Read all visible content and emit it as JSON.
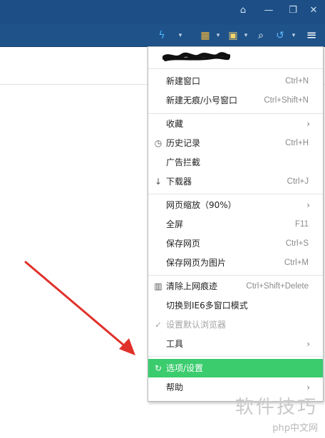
{
  "window": {
    "buttons": [
      {
        "name": "shirt-icon",
        "glyph": "⌂"
      },
      {
        "name": "minimize-icon",
        "glyph": "—"
      },
      {
        "name": "restore-icon",
        "glyph": "❐"
      },
      {
        "name": "close-icon",
        "glyph": "✕"
      }
    ]
  },
  "toolbar": {
    "lightning_icon": "ϟ",
    "dropdown": "▾",
    "apps_icon": "▦",
    "notes_icon": "▣",
    "search_icon": "⌕",
    "undo_icon": "↺",
    "menu_icon": "≡"
  },
  "menu": {
    "items": [
      {
        "label": "新建窗口",
        "shortcut": "Ctrl+N"
      },
      {
        "label": "新建无痕/小号窗口",
        "shortcut": "Ctrl+Shift+N"
      },
      {
        "label": "收藏",
        "submenu": "›"
      },
      {
        "label": "历史记录",
        "shortcut": "Ctrl+H",
        "icon": "clock-icon",
        "glyph": "◷"
      },
      {
        "label": "广告拦截"
      },
      {
        "label": "下载器",
        "shortcut": "Ctrl+J",
        "icon": "download-icon",
        "glyph": "↓"
      },
      {
        "label": "网页缩放（90%）",
        "submenu": "›"
      },
      {
        "label": "全屏",
        "shortcut": "F11"
      },
      {
        "label": "保存网页",
        "shortcut": "Ctrl+S"
      },
      {
        "label": "保存网页为图片",
        "shortcut": "Ctrl+M"
      },
      {
        "label": "清除上网痕迹",
        "shortcut": "Ctrl+Shift+Delete",
        "icon": "trash-icon",
        "glyph": "▥"
      },
      {
        "label": "切换到IE6多窗口模式"
      },
      {
        "label": "设置默认浏览器",
        "icon": "check-icon",
        "glyph": "✓",
        "disabled": true
      },
      {
        "label": "工具",
        "submenu": "›"
      },
      {
        "label": "选项/设置",
        "icon": "settings-icon",
        "glyph": "↻",
        "highlighted": true
      },
      {
        "label": "帮助",
        "submenu": "›"
      }
    ]
  },
  "watermark": {
    "line1": "软件技巧",
    "line2": "php中文网"
  },
  "colors": {
    "titlebar": "#1d4f86",
    "highlight": "#3bcc6e",
    "arrow": "#e0302a"
  }
}
